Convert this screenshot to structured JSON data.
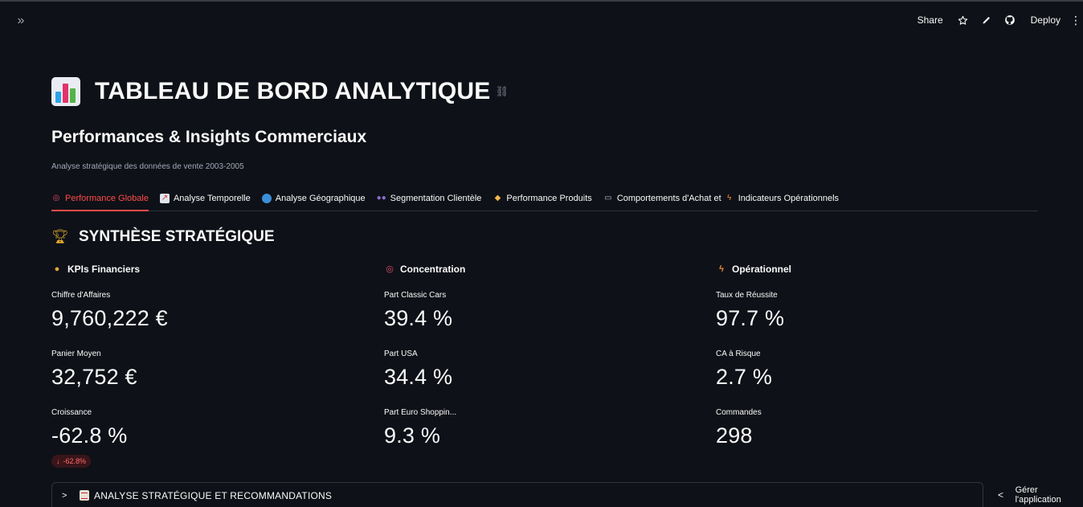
{
  "toolbar": {
    "share_label": "Share",
    "deploy_label": "Deploy",
    "icons": [
      "star-icon",
      "edit-icon",
      "github-icon",
      "more-menu-icon"
    ]
  },
  "sidebar_toggle_icon": "double-chevron-right-icon",
  "header": {
    "title": "TABLEAU DE BORD ANALYTIQUE",
    "subtitle": "Performances & Insights Commerciaux",
    "caption": "Analyse stratégique des données de vente 2003-2005"
  },
  "tabs": [
    {
      "icon": "target-icon",
      "label": "Performance Globale",
      "active": true
    },
    {
      "icon": "chart-icon",
      "label": "Analyse Temporelle",
      "active": false
    },
    {
      "icon": "globe-icon",
      "label": "Analyse Géographique",
      "active": false
    },
    {
      "icon": "people-icon",
      "label": "Segmentation Clientèle",
      "active": false
    },
    {
      "icon": "tag-icon",
      "label": "Performance Produits",
      "active": false
    },
    {
      "icon": "cart-icon",
      "label": "Comportements d'Achat et",
      "active": false
    },
    {
      "icon": "lightning-icon",
      "label": "Indicateurs Opérationnels",
      "active": false
    }
  ],
  "section": {
    "title": "SYNTHÈSE STRATÉGIQUE",
    "icon": "trophy-icon"
  },
  "columns": [
    {
      "icon": "money-bag-icon",
      "title": "KPIs Financiers",
      "metrics": [
        {
          "label": "Chiffre d'Affaires",
          "value": "9,760,222 €"
        },
        {
          "label": "Panier Moyen",
          "value": "32,752 €"
        },
        {
          "label": "Croissance",
          "value": "-62.8 %",
          "delta": "-62.8%"
        }
      ]
    },
    {
      "icon": "target-icon",
      "title": "Concentration",
      "metrics": [
        {
          "label": "Part Classic Cars",
          "value": "39.4 %"
        },
        {
          "label": "Part USA",
          "value": "34.4 %"
        },
        {
          "label": "Part Euro Shoppin...",
          "value": "9.3 %"
        }
      ]
    },
    {
      "icon": "lightning-icon",
      "title": "Opérationnel",
      "metrics": [
        {
          "label": "Taux de Réussite",
          "value": "97.7 %"
        },
        {
          "label": "CA à Risque",
          "value": "2.7 %"
        },
        {
          "label": "Commandes",
          "value": "298"
        }
      ]
    }
  ],
  "expander": {
    "label": "ANALYSE STRATÉGIQUE ET RECOMMANDATIONS",
    "icon": "clipboard-icon"
  },
  "manage_app_label": "Gérer l'application",
  "colors": {
    "background": "#0e1117",
    "accent": "#ff4b4b",
    "text": "#fafafa",
    "muted": "#a3a8b8"
  }
}
